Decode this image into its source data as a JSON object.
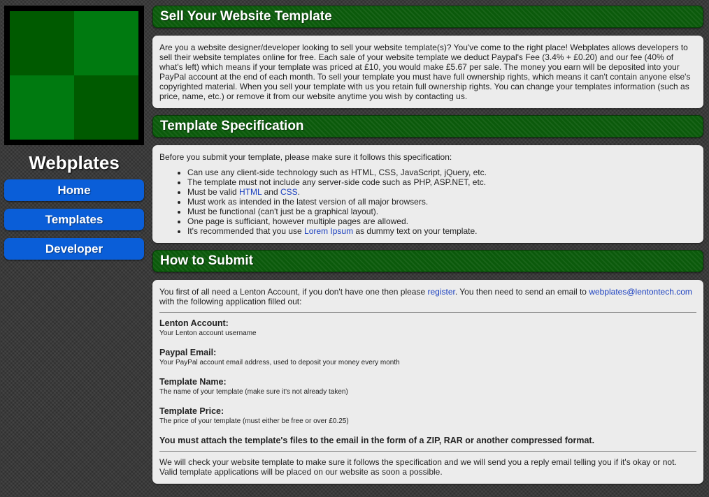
{
  "sidebar": {
    "site_name": "Webplates",
    "nav": [
      "Home",
      "Templates",
      "Developer"
    ]
  },
  "section1": {
    "title": "Sell Your Website Template",
    "text": "Are you a website designer/developer looking to sell your website template(s)? You've come to the right place! Webplates allows developers to sell their website templates online for free. Each sale of your website template we deduct Paypal's Fee (3.4% + £0.20) and our fee (40% of what's left) which means if your template was priced at £10, you would make £5.67 per sale. The money you earn will be deposited into your PayPal account at the end of each month. To sell your template you must have full ownership rights, which means it can't contain anyone else's copyrighted material. When you sell your template with us you retain full ownership rights. You can change your templates information (such as price, name, etc.) or remove it from our website anytime you wish by contacting us."
  },
  "section2": {
    "title": "Template Specification",
    "intro": "Before you submit your template, please make sure it follows this specification:",
    "item1": "Can use any client-side technology such as HTML, CSS, JavaScript, jQuery, etc.",
    "item2": "The template must not include any server-side code such as PHP, ASP.NET, etc.",
    "item3_pre": "Must be valid ",
    "item3_link1": "HTML",
    "item3_mid": " and ",
    "item3_link2": "CSS",
    "item3_post": ".",
    "item4": "Must work as intended in the latest version of all major browsers.",
    "item5": "Must be functional (can't just be a graphical layout).",
    "item6": "One page is sufficiant, however multiple pages are allowed.",
    "item7_pre": "It's recommended that you use ",
    "item7_link": "Lorem Ipsum",
    "item7_post": " as dummy text on your template."
  },
  "section3": {
    "title": "How to Submit",
    "intro_pre": "You first of all need a Lenton Account, if you don't have one then please ",
    "register_link": "register",
    "intro_mid": ". You then need to send an email to ",
    "email_link": "webplates@lentontech.com",
    "intro_post": " with the following application filled out:",
    "fields": [
      {
        "label": "Lenton Account:",
        "desc": "Your Lenton account username"
      },
      {
        "label": "Paypal Email:",
        "desc": "Your PayPal account email address, used to deposit your money every month"
      },
      {
        "label": "Template Name:",
        "desc": "The name of your template (make sure it's not already taken)"
      },
      {
        "label": "Template Price:",
        "desc": "The price of your template (must either be free or over £0.25)"
      }
    ],
    "attach_note": "You must attach the template's files to the email in the form of a ZIP, RAR or another compressed format.",
    "closing": "We will check your website template to make sure it follows the specification and we will send you a reply email telling you if it's okay or not. Valid template applications will be placed on our website as soon a possible."
  }
}
